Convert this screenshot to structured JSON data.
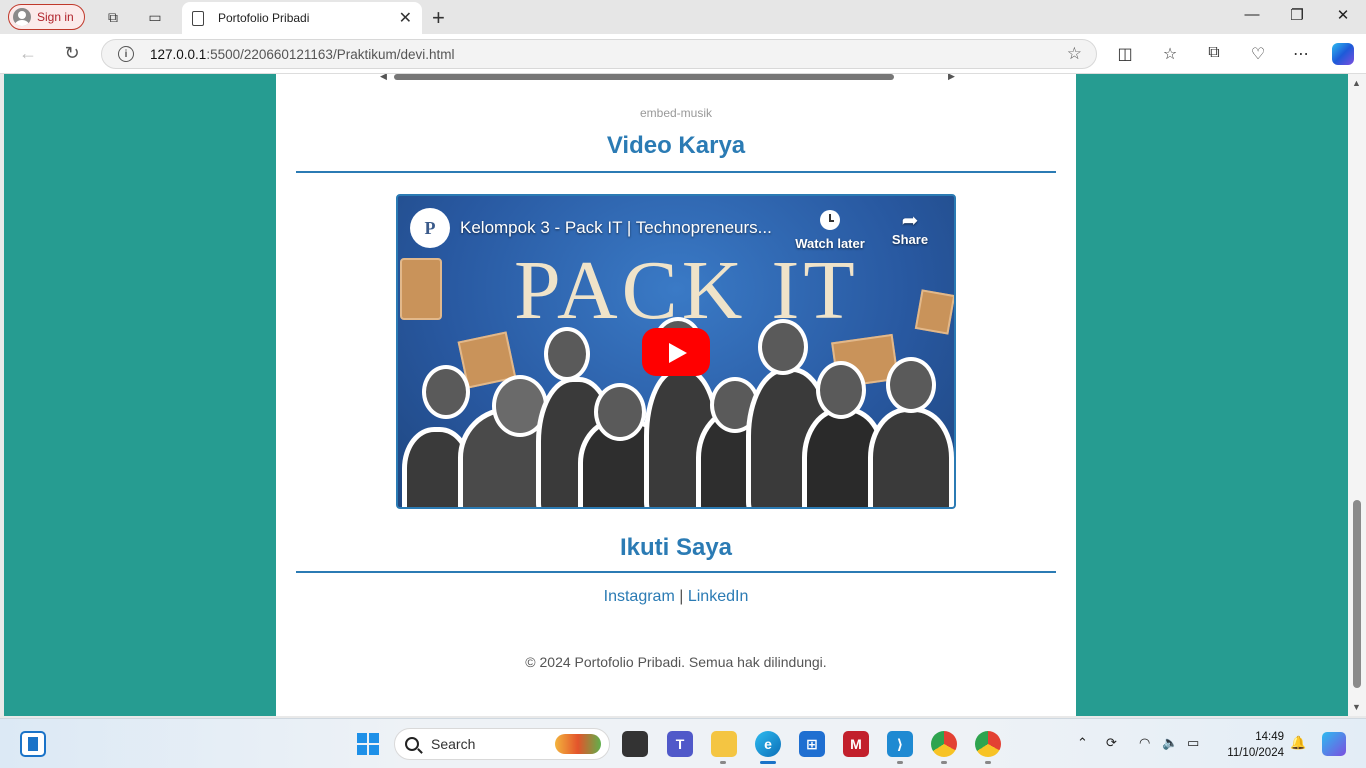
{
  "browser": {
    "signin_label": "Sign in",
    "tab_title": "Portofolio Pribadi",
    "tab_close": "✕",
    "new_tab": "+",
    "url_host": "127.0.0.1",
    "url_rest": ":5500/220660121163/Praktikum/devi.html",
    "window_controls": [
      "—",
      "❐",
      "✕"
    ]
  },
  "page": {
    "embed_label": "embed-musik",
    "video_section_title": "Video Karya",
    "video": {
      "channel_logo": "P",
      "title": "Kelompok 3 - Pack IT | Technopreneurs...",
      "thumbnail_word": "PACK IT",
      "watch_later": "Watch later",
      "share": "Share"
    },
    "follow_section_title": "Ikuti Saya",
    "links": {
      "instagram": "Instagram",
      "separator": "|",
      "linkedin": "LinkedIn"
    },
    "footer": "© 2024 Portofolio Pribadi. Semua hak dilindungi."
  },
  "taskbar": {
    "search_placeholder": "Search",
    "time": "14:49",
    "date": "11/10/2024"
  },
  "colors": {
    "page_bg": "#269c91",
    "accent": "#2b7bb4",
    "youtube_red": "#ff0000"
  }
}
